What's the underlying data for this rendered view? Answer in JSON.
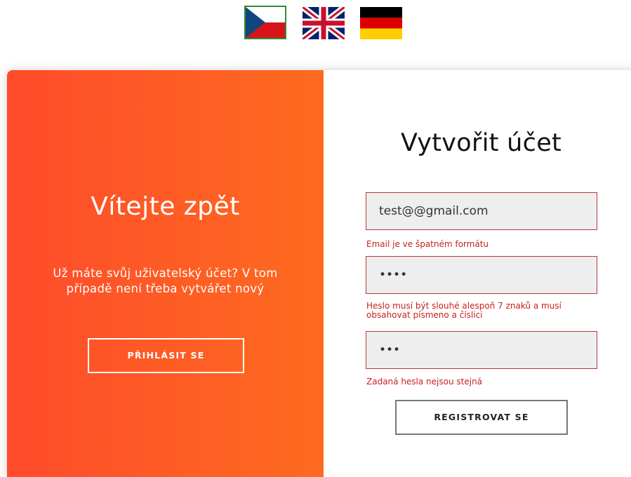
{
  "languages": [
    {
      "code": "cs",
      "icon": "czech-flag-icon",
      "selected": true
    },
    {
      "code": "en",
      "icon": "uk-flag-icon",
      "selected": false
    },
    {
      "code": "de",
      "icon": "german-flag-icon",
      "selected": false
    }
  ],
  "overlay": {
    "title": "Vítejte zpět",
    "text": "Už máte svůj uživatelský účet? V tom případě není třeba vytvářet nový",
    "login_button": "PŘIHLÁSIT SE"
  },
  "form": {
    "title": "Vytvořit účet",
    "email_value": "test@@gmail.com",
    "email_error": "Email je ve špatném formátu",
    "password_value": "1234",
    "password_error": "Heslo musí být slouhé alespoň 7 znaků a musí obsahovat písmeno a číslici",
    "confirm_value": "123",
    "confirm_error": "Zadaná hesla nejsou stejná",
    "register_button": "REGISTROVAT SE"
  },
  "colors": {
    "gradient_start": "#ff4b2b",
    "gradient_end": "#fd6b1f",
    "error": "#c8201f",
    "field_border": "#b03a3a",
    "selected_flag_border": "#2e8b2e"
  }
}
